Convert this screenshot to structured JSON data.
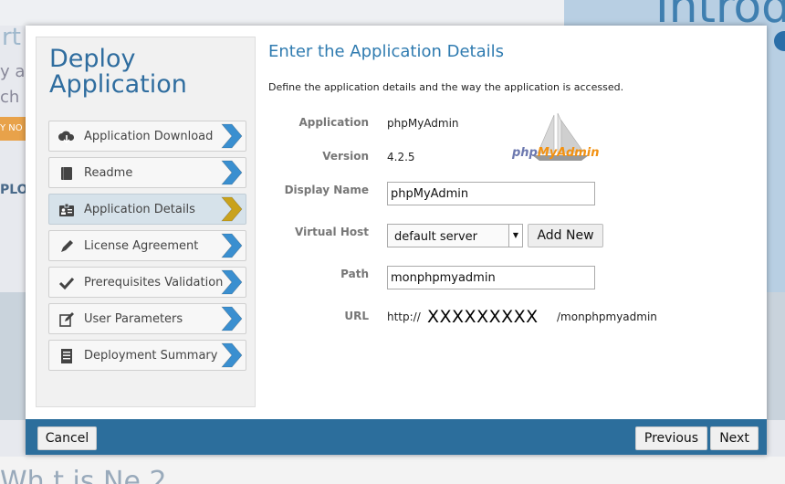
{
  "background": {
    "big_text": "Introd",
    "left_text1": "rt",
    "left_text2": "y a",
    "left_text3": "ch",
    "orange_label": "Y NO",
    "plo_text": "PLO",
    "bottom_text": "Wh t is Ne  2"
  },
  "wizard": {
    "title": "Deploy Application",
    "steps": [
      {
        "label": "Application Download",
        "icon": "cloud-download-icon",
        "active": false
      },
      {
        "label": "Readme",
        "icon": "book-icon",
        "active": false
      },
      {
        "label": "Application Details",
        "icon": "id-card-icon",
        "active": true
      },
      {
        "label": "License Agreement",
        "icon": "pen-icon",
        "active": false
      },
      {
        "label": "Prerequisites Validation",
        "icon": "checkmark-icon",
        "active": false
      },
      {
        "label": "User Parameters",
        "icon": "edit-icon",
        "active": false
      },
      {
        "label": "Deployment Summary",
        "icon": "list-document-icon",
        "active": false
      }
    ]
  },
  "details": {
    "title": "Enter the Application Details",
    "description": "Define the application details and the way the application is accessed.",
    "application_label": "Application",
    "application_value": "phpMyAdmin",
    "version_label": "Version",
    "version_value": "4.2.5",
    "display_name_label": "Display Name",
    "display_name_value": "phpMyAdmin",
    "virtual_host_label": "Virtual Host",
    "virtual_host_value": "default server",
    "add_new_label": "Add New",
    "path_label": "Path",
    "path_value": "monphpmyadmin",
    "url_label": "URL",
    "url_prefix": "http://",
    "url_masked": "XXXXXXXXX",
    "url_suffix": "/monphpmyadmin",
    "logo_text_php": "php",
    "logo_text_myadmin": "MyAdmin"
  },
  "footer": {
    "cancel_label": "Cancel",
    "previous_label": "Previous",
    "next_label": "Next"
  },
  "colors": {
    "accent": "#2f6d9f",
    "footer": "#2c6e9c",
    "chevron_blue": "#3a8fd0",
    "chevron_gold": "#c9a21c"
  }
}
